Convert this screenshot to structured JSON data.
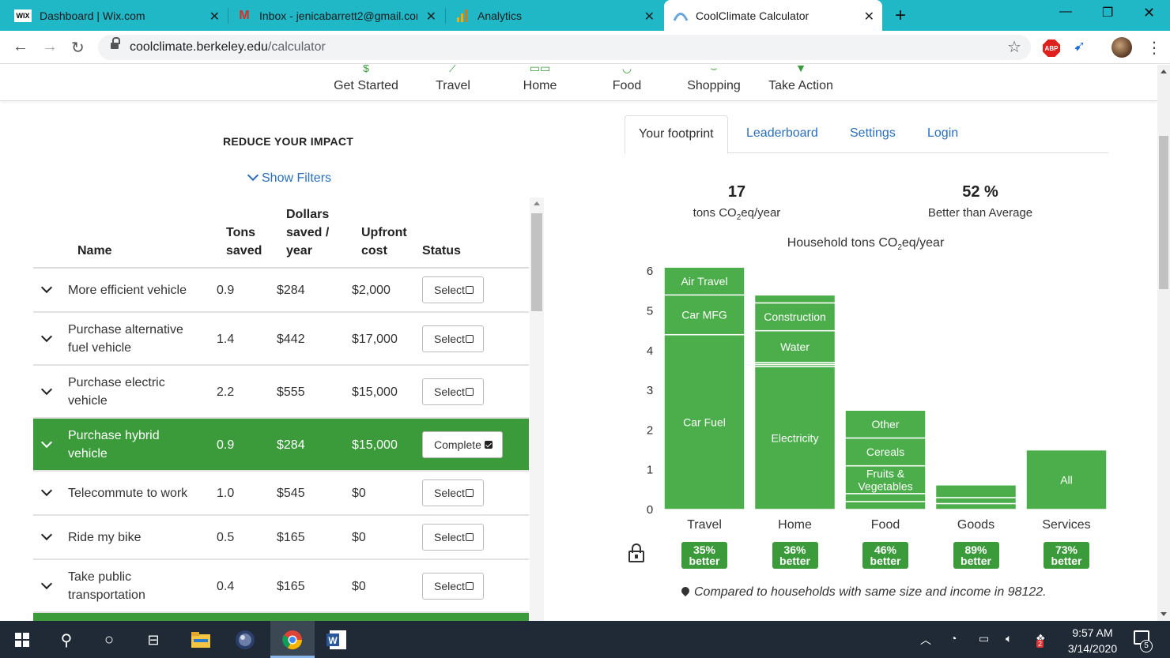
{
  "browser": {
    "tabs": [
      {
        "title": "Dashboard | Wix.com",
        "icon": "wix-icon",
        "active": false
      },
      {
        "title": "Inbox - jenicabarrett2@gmail.cor",
        "icon": "gmail-icon",
        "active": false
      },
      {
        "title": "Analytics",
        "icon": "analytics-icon",
        "active": false
      },
      {
        "title": "CoolClimate Calculator",
        "icon": "coolclimate-icon",
        "active": true
      }
    ],
    "new_tab": "+",
    "url_host": "coolclimate.berkeley.edu",
    "url_path": "/calculator",
    "abp_label": "ABP"
  },
  "topnav": {
    "items": [
      "Get Started",
      "Travel",
      "Home",
      "Food",
      "Shopping",
      "Take Action"
    ]
  },
  "reduce": {
    "title": "REDUCE YOUR IMPACT",
    "filters_label": "Show Filters",
    "headers": {
      "name": "Name",
      "tons_1": "Tons",
      "tons_2": "saved",
      "dollars_1": "Dollars",
      "dollars_2": "saved /",
      "dollars_3": "year",
      "upfront_1": "Upfront",
      "upfront_2": "cost",
      "status": "Status"
    },
    "rows": [
      {
        "name": "More efficient vehicle",
        "tons": "0.9",
        "dollars": "$284",
        "upfront": "$2,000",
        "status": "Select"
      },
      {
        "name": "Purchase alternative fuel vehicle",
        "tons": "1.4",
        "dollars": "$442",
        "upfront": "$17,000",
        "status": "Select"
      },
      {
        "name": "Purchase electric vehicle",
        "tons": "2.2",
        "dollars": "$555",
        "upfront": "$15,000",
        "status": "Select"
      },
      {
        "name": "Purchase hybrid vehicle",
        "tons": "0.9",
        "dollars": "$284",
        "upfront": "$15,000",
        "status": "Complete"
      },
      {
        "name": "Telecommute to work",
        "tons": "1.0",
        "dollars": "$545",
        "upfront": "$0",
        "status": "Select"
      },
      {
        "name": "Ride my bike",
        "tons": "0.5",
        "dollars": "$165",
        "upfront": "$0",
        "status": "Select"
      },
      {
        "name": "Take public transportation",
        "tons": "0.4",
        "dollars": "$165",
        "upfront": "$0",
        "status": "Select"
      }
    ]
  },
  "footprint": {
    "tabs": [
      "Your footprint",
      "Leaderboard",
      "Settings",
      "Login"
    ],
    "total_value": "17",
    "total_unit_pre": "tons CO",
    "total_unit_sub": "2",
    "total_unit_post": "eq/year",
    "better_value": "52 %",
    "better_label": "Better than Average",
    "chart_title_pre": "Household tons CO",
    "chart_title_sub": "2",
    "chart_title_post": "eq/year",
    "compare_text": "Compared to households with same size and income in 98122."
  },
  "chart_data": {
    "type": "bar",
    "stacked": true,
    "title": "Household tons CO2eq/year",
    "ylim": [
      0,
      6
    ],
    "yticks": [
      0,
      1,
      2,
      3,
      4,
      5,
      6
    ],
    "colors": {
      "bar": "#4bae4b",
      "separator": "#ffffff"
    },
    "categories": [
      "Travel",
      "Home",
      "Food",
      "Goods",
      "Services"
    ],
    "stacks": [
      {
        "category": "Travel",
        "segments": [
          {
            "label": "Car Fuel",
            "value": 4.4
          },
          {
            "label": "Car MFG",
            "value": 1.0
          },
          {
            "label": "Air Travel",
            "value": 0.7
          }
        ]
      },
      {
        "category": "Home",
        "segments": [
          {
            "label": "Electricity",
            "value": 3.6
          },
          {
            "label": "",
            "value": 0.05
          },
          {
            "label": "",
            "value": 0.05
          },
          {
            "label": "Water",
            "value": 0.8
          },
          {
            "label": "Construction",
            "value": 0.7
          },
          {
            "label": "",
            "value": 0.2
          }
        ]
      },
      {
        "category": "Food",
        "segments": [
          {
            "label": "",
            "value": 0.2
          },
          {
            "label": "",
            "value": 0.2
          },
          {
            "label": "Fruits & Vegetables",
            "value": 0.7
          },
          {
            "label": "Cereals",
            "value": 0.7
          },
          {
            "label": "Other",
            "value": 0.7
          }
        ]
      },
      {
        "category": "Goods",
        "segments": [
          {
            "label": "",
            "value": 0.15
          },
          {
            "label": "",
            "value": 0.15
          },
          {
            "label": "",
            "value": 0.32
          }
        ]
      },
      {
        "category": "Services",
        "segments": [
          {
            "label": "All",
            "value": 1.5
          }
        ]
      }
    ],
    "better_badges": [
      {
        "line1": "35%",
        "line2": "better"
      },
      {
        "line1": "36%",
        "line2": "better"
      },
      {
        "line1": "46%",
        "line2": "better"
      },
      {
        "line1": "89%",
        "line2": "better"
      },
      {
        "line1": "73%",
        "line2": "better"
      }
    ]
  },
  "taskbar": {
    "time": "9:57 AM",
    "date": "3/14/2020",
    "notification_count": "5",
    "dropbox_badge": "2"
  }
}
